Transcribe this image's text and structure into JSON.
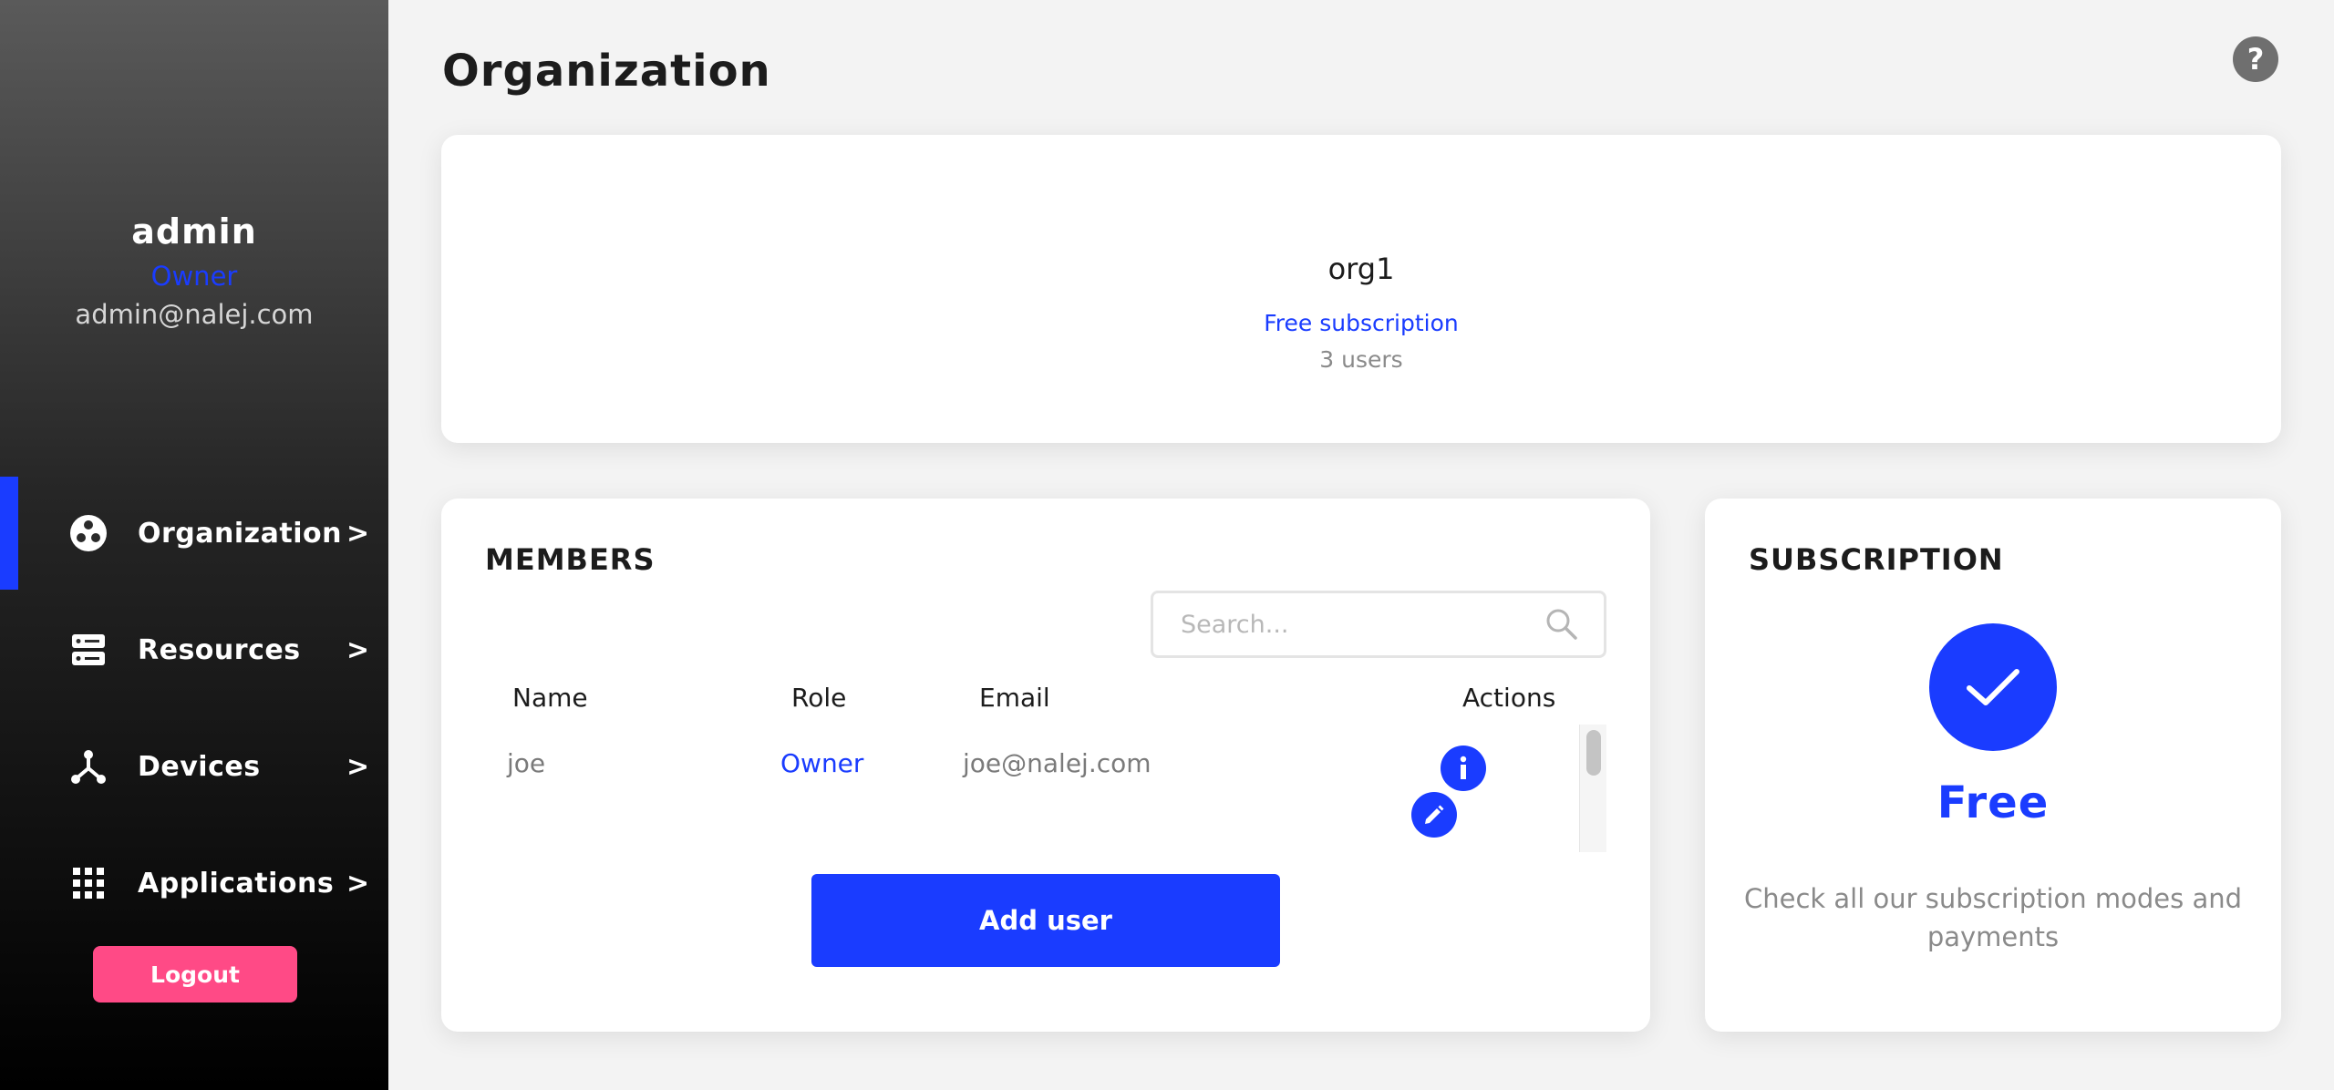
{
  "sidebar": {
    "profile": {
      "username": "admin",
      "role": "Owner",
      "email": "admin@nalej.com"
    },
    "items": [
      {
        "label": "Organization",
        "chevron": ">",
        "icon": "organization-icon",
        "active": true
      },
      {
        "label": "Resources",
        "chevron": ">",
        "icon": "resources-icon",
        "active": false
      },
      {
        "label": "Devices",
        "chevron": ">",
        "icon": "devices-icon",
        "active": false
      },
      {
        "label": "Applications",
        "chevron": ">",
        "icon": "applications-icon",
        "active": false
      }
    ],
    "logout_label": "Logout"
  },
  "header": {
    "title": "Organization",
    "help_label": "?"
  },
  "organization": {
    "name": "org1",
    "subscription": "Free subscription",
    "users": "3 users"
  },
  "members": {
    "title": "MEMBERS",
    "search_placeholder": "Search...",
    "columns": [
      "Name",
      "Role",
      "Email",
      "Actions"
    ],
    "rows": [
      {
        "name": "joe",
        "role": "Owner",
        "email": "joe@nalej.com"
      }
    ],
    "add_user_label": "Add user"
  },
  "subscription": {
    "title": "SUBSCRIPTION",
    "plan": "Free",
    "description": "Check all our subscription modes and payments"
  },
  "colors": {
    "accent": "#1a3cff",
    "logout": "#ff4a86",
    "background": "#f3f3f3"
  }
}
